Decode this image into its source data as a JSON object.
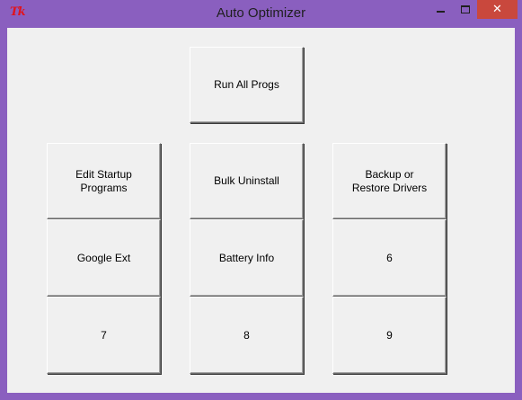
{
  "window": {
    "title": "Auto Optimizer",
    "icon_text": "Tk",
    "controls": [
      "minimize-icon",
      "maximize-icon",
      "close-icon"
    ],
    "close_glyph": "✕"
  },
  "colors": {
    "frame": "#8a5fbf",
    "close_button": "#c9483d",
    "client_background": "#f0f0f0"
  },
  "buttons": {
    "run_all": "Run All Progs",
    "edit_startup": "Edit Startup\nPrograms",
    "bulk_uninstall": "Bulk Uninstall",
    "backup_drivers": "Backup or\nRestore Drivers",
    "google_ext": "Google Ext",
    "battery_info": "Battery Info",
    "b6": "6",
    "b7": "7",
    "b8": "8",
    "b9": "9"
  }
}
